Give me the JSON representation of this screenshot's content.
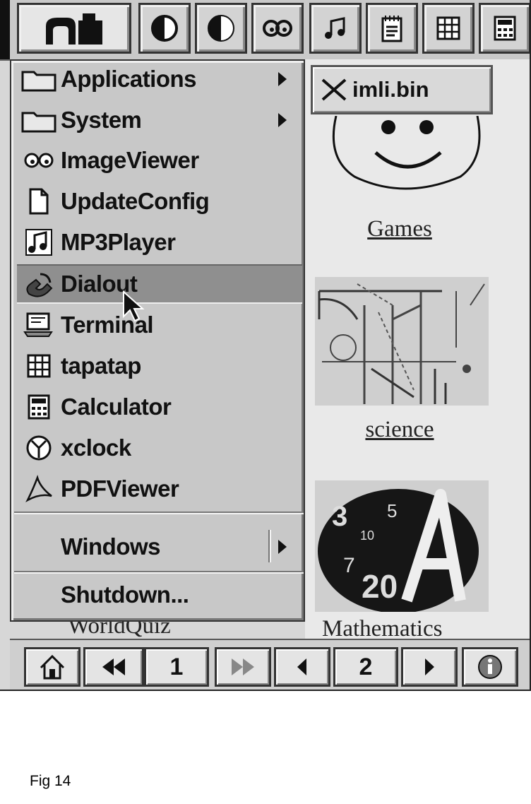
{
  "window_button": {
    "label": "imli.bin"
  },
  "desktop_icons": [
    {
      "label": "Games"
    },
    {
      "label": "science"
    },
    {
      "label": "Mathematics"
    },
    {
      "label": "WorldQuiz"
    }
  ],
  "menu": {
    "items": [
      {
        "label": "Applications",
        "icon": "folder-icon"
      },
      {
        "label": "System",
        "icon": "folder-icon"
      },
      {
        "label": "ImageViewer",
        "icon": "image-viewer-icon"
      },
      {
        "label": "UpdateConfig",
        "icon": "document-icon"
      },
      {
        "label": "MP3Player",
        "icon": "music-note-icon"
      },
      {
        "label": "Dialout",
        "icon": "phone-icon"
      },
      {
        "label": "Terminal",
        "icon": "terminal-icon"
      },
      {
        "label": "tapatap",
        "icon": "grid-icon"
      },
      {
        "label": "Calculator",
        "icon": "calculator-icon"
      },
      {
        "label": "xclock",
        "icon": "clock-icon"
      },
      {
        "label": "PDFViewer",
        "icon": "pdf-icon"
      },
      {
        "label": "Windows"
      },
      {
        "label": "Shutdown..."
      }
    ]
  },
  "pager": {
    "page_a": "1",
    "page_b": "2"
  },
  "caption": "Fig 14"
}
